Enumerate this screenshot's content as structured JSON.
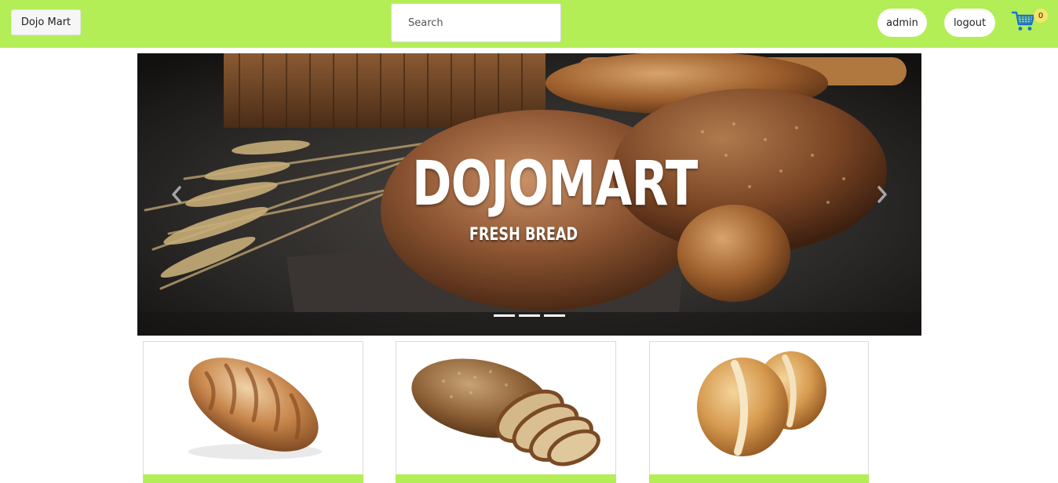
{
  "navbar": {
    "brand": "Dojo Mart",
    "search_placeholder": "Search",
    "admin_label": "admin",
    "logout_label": "logout",
    "cart_count": "0",
    "accent_color": "#b3ee56"
  },
  "carousel": {
    "title": "DOJOMART",
    "subtitle": "FRESH BREAD",
    "slide_count": 3,
    "active_slide": 1
  },
  "products": [
    {
      "name": "white-loaf",
      "icon": "bread-loaf-image"
    },
    {
      "name": "sliced-seeded-bread",
      "icon": "sliced-bread-image"
    },
    {
      "name": "bread-rolls",
      "icon": "bread-rolls-image"
    }
  ]
}
